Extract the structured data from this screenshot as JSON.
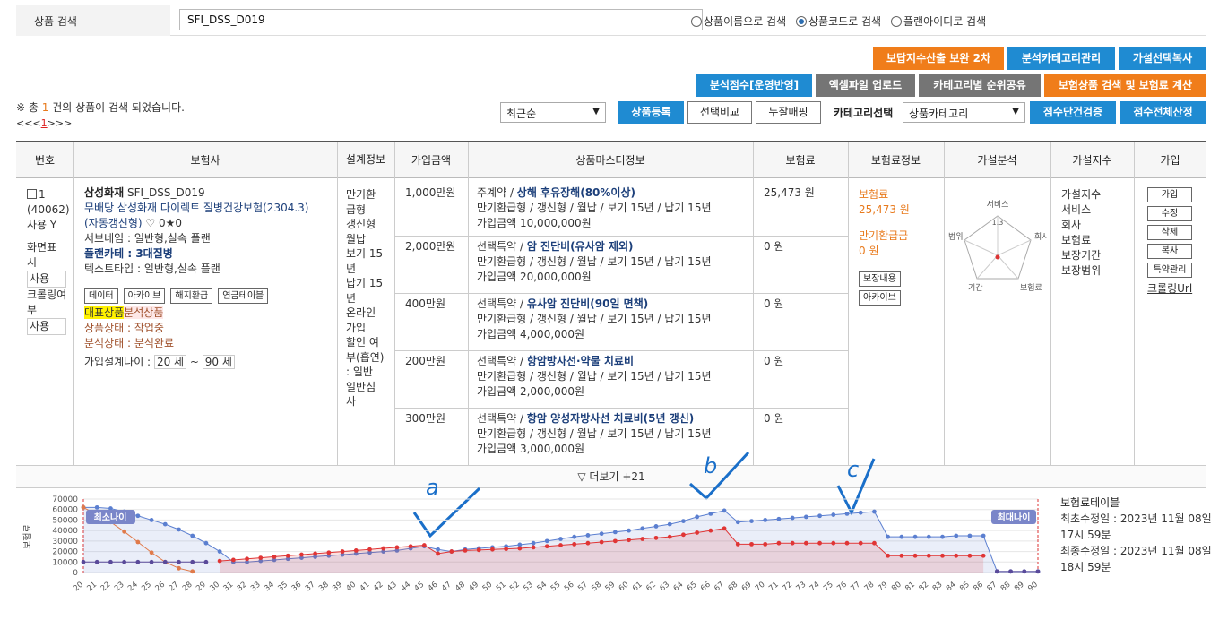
{
  "search": {
    "label": "상품 검색",
    "value": "SFI_DSS_D019",
    "options": [
      {
        "label": "상품이름으로 검색",
        "checked": false
      },
      {
        "label": "상품코드로 검색",
        "checked": true
      },
      {
        "label": "플랜아이디로 검색",
        "checked": false
      }
    ]
  },
  "toolbar": {
    "row1": [
      "보답지수산출 보완 2차",
      "분석카테고리관리",
      "가설선택복사"
    ],
    "row2": [
      "분석점수[운영반영]",
      "엑셀파일 업로드",
      "카테고리별 순위공유",
      "보험상품 검색 및 보험료 계산"
    ],
    "sort_select": "최근순",
    "row3": [
      "상품등록",
      "선택비교",
      "누잘매핑"
    ],
    "category_label": "카테고리선택",
    "category_select": "상품카테고리",
    "row3_right": [
      "점수단건검증",
      "점수전체산정"
    ]
  },
  "result": {
    "prefix": "※ 총 ",
    "count": "1",
    "suffix": " 건의 상품이 검색 되었습니다.",
    "pager_prev": "<<<",
    "pager_current": "1",
    "pager_next": ">>>"
  },
  "table": {
    "headers": [
      "번호",
      "보험사",
      "설계정보",
      "가입금액",
      "상품마스터정보",
      "보험료",
      "보험료정보",
      "가설분석",
      "가설지수",
      "가입"
    ],
    "row": {
      "no": "1",
      "id": "(40062)",
      "use_label": "사용 Y",
      "display_label": "화면표시",
      "display_value": "사용",
      "crawl_label": "크롤링여부",
      "crawl_value": "사용",
      "company": "삼성화재",
      "code": "SFI_DSS_D019",
      "product_name_1": "무배당 삼성화재 다이렉트 질병건강보험(2304.3)",
      "product_name_2": "(자동갱신형)",
      "likes": "♡ 0★0",
      "service_name": "서브네임 : 일반형,실속 플랜",
      "plan_category": "플랜카테 : 3대질병",
      "text_type": "텍스트타입 : 일반형,실속 플랜",
      "action_buttons": [
        "데이터",
        "아카이브",
        "해지환급",
        "연금테이블"
      ],
      "tag1": "대표상품",
      "tag2": "분석상품",
      "status": "상품상태 : 작업중",
      "analysis_status": "분석상태 : 분석완료",
      "age_label": "가입설계나이 :",
      "age_min": "20 세",
      "age_sep": "~",
      "age_max": "90 세",
      "design_info": [
        "만기환",
        "급형",
        "갱신형",
        "월납",
        "보기 15",
        "년",
        "납기 15",
        "년",
        "온라인",
        "가입",
        "할인 여",
        "부(흡연)",
        ": 일반",
        "일반심",
        "사"
      ],
      "coverages": [
        {
          "amount": "1,000만원",
          "type": "주계약",
          "name": "상해 후유장해(80%이상)",
          "detail": "만기환급형 / 갱신형 / 월납 / 보기 15년 / 납기 15년",
          "join": "가입금액 10,000,000원",
          "premium": "25,473 원"
        },
        {
          "amount": "2,000만원",
          "type": "선택특약",
          "name": "암 진단비(유사암 제외)",
          "detail": "만기환급형 / 갱신형 / 월납 / 보기 15년 / 납기 15년",
          "join": "가입금액 20,000,000원",
          "premium": "0 원"
        },
        {
          "amount": "400만원",
          "type": "선택특약",
          "name": "유사암 진단비(90일 면책)",
          "detail": "만기환급형 / 갱신형 / 월납 / 보기 15년 / 납기 15년",
          "join": "가입금액 4,000,000원",
          "premium": "0 원"
        },
        {
          "amount": "200만원",
          "type": "선택특약",
          "name": "항암방사선·약물 치료비",
          "detail": "만기환급형 / 갱신형 / 월납 / 보기 15년 / 납기 15년",
          "join": "가입금액 2,000,000원",
          "premium": "0 원"
        },
        {
          "amount": "300만원",
          "type": "선택특약",
          "name": "항암 양성자방사선 치료비(5년 갱신)",
          "detail": "만기환급형 / 갱신형 / 월납 / 보기 15년 / 납기 15년",
          "join": "가입금액 3,000,000원",
          "premium": "0 원"
        }
      ],
      "premium_info": {
        "premium_label": "보험료",
        "premium_value": "25,473 원",
        "refund_label": "만기환급금",
        "refund_value": "0 원",
        "buttons": [
          "보장내용",
          "아카이브"
        ]
      },
      "radar": {
        "labels": [
          "서비스",
          "회사",
          "보험료",
          "기간",
          "범위"
        ],
        "value_label": "1.3"
      },
      "index_items": [
        "가설지수",
        "서비스",
        "회사",
        "보험료",
        "보장기간",
        "보장범위"
      ],
      "join_buttons": [
        "가입",
        "수정",
        "삭제",
        "복사",
        "특약관리"
      ],
      "crawl_url": "크롤링Url"
    }
  },
  "more": {
    "label": "▽ 더보기 +21"
  },
  "annotations": [
    "a",
    "b",
    "c"
  ],
  "chart_panel": {
    "title": "보험료테이블",
    "first_modified": "최초수정일 : 2023년 11월 08일 17시 59분",
    "last_modified": "최종수정일 : 2023년 11월 08일 18시 59분",
    "min_age_badge": "최소나이",
    "max_age_badge": "최대나이",
    "y_axis_label": "보험료"
  },
  "colors": {
    "blue_series": "#5b7fd0",
    "red_series": "#e03535",
    "orange_series": "#e07a4a",
    "purple_series": "#5a4a9a"
  },
  "chart_data": {
    "type": "line",
    "x": [
      20,
      21,
      22,
      23,
      24,
      25,
      26,
      27,
      28,
      29,
      30,
      31,
      32,
      33,
      34,
      35,
      36,
      37,
      38,
      39,
      40,
      41,
      42,
      43,
      44,
      45,
      46,
      47,
      48,
      49,
      50,
      51,
      52,
      53,
      54,
      55,
      56,
      57,
      58,
      59,
      60,
      61,
      62,
      63,
      64,
      65,
      66,
      67,
      68,
      69,
      70,
      71,
      72,
      73,
      74,
      75,
      76,
      77,
      78,
      79,
      80,
      81,
      82,
      83,
      84,
      85,
      86,
      87,
      88,
      89,
      90
    ],
    "ylim": [
      0,
      70000
    ],
    "yticks": [
      0,
      10000,
      20000,
      30000,
      40000,
      50000,
      60000,
      70000
    ],
    "series": [
      {
        "color": "#5b7fd0",
        "values": [
          62000,
          62000,
          61000,
          58000,
          54000,
          50000,
          46000,
          41000,
          35000,
          28000,
          20000,
          10000,
          10000,
          11000,
          12000,
          13000,
          14000,
          15000,
          16000,
          17000,
          18000,
          19000,
          20000,
          21000,
          23000,
          25000,
          22000,
          20000,
          22000,
          23000,
          24000,
          25000,
          26500,
          28000,
          30000,
          32000,
          34000,
          35500,
          37000,
          38500,
          40000,
          42000,
          44000,
          46000,
          49000,
          53000,
          56000,
          59000,
          48000,
          49000,
          50000,
          51000,
          52000,
          53000,
          54000,
          55000,
          56000,
          57000,
          58000,
          34000,
          34000,
          34000,
          34000,
          34000,
          35000,
          35000,
          35000,
          1000,
          1000,
          1000,
          1000
        ]
      },
      {
        "color": "#e03535",
        "values": [
          null,
          null,
          null,
          null,
          null,
          null,
          null,
          null,
          null,
          null,
          11000,
          12000,
          13000,
          14000,
          15000,
          16000,
          17000,
          18000,
          19000,
          20000,
          21000,
          22000,
          23000,
          24000,
          25000,
          26000,
          18000,
          20000,
          21000,
          21500,
          22000,
          22500,
          23000,
          24000,
          25000,
          26000,
          27000,
          28000,
          29000,
          30000,
          31000,
          32000,
          33000,
          34000,
          36000,
          38000,
          40000,
          42000,
          27000,
          27000,
          27000,
          28000,
          28000,
          28000,
          28000,
          28000,
          28000,
          28000,
          28000,
          16000,
          16000,
          16000,
          16000,
          16000,
          16000,
          16000,
          16000,
          null,
          null,
          null,
          null
        ]
      },
      {
        "color": "#e07a4a",
        "values": [
          62000,
          55000,
          48000,
          39000,
          29000,
          19000,
          10000,
          4000,
          1000,
          null,
          null,
          null,
          null,
          null,
          null,
          null,
          null,
          null,
          null,
          null,
          null,
          null,
          null,
          null,
          null,
          null,
          null,
          null,
          null,
          null,
          null,
          null,
          null,
          null,
          null,
          null,
          null,
          null,
          null,
          null,
          null,
          null,
          null,
          null,
          null,
          null,
          null,
          null,
          null,
          null,
          null,
          null,
          null,
          null,
          null,
          null,
          null,
          null,
          null,
          null,
          null,
          null,
          null,
          null,
          null,
          null,
          null,
          null,
          null,
          null,
          null
        ]
      },
      {
        "color": "#5a4a9a",
        "values": [
          10000,
          10000,
          10000,
          10000,
          10000,
          10000,
          10000,
          10000,
          10000,
          10000,
          null,
          null,
          null,
          null,
          null,
          null,
          null,
          null,
          null,
          null,
          null,
          null,
          null,
          null,
          null,
          null,
          null,
          null,
          null,
          null,
          null,
          null,
          null,
          null,
          null,
          null,
          null,
          null,
          null,
          null,
          null,
          null,
          null,
          null,
          null,
          null,
          null,
          null,
          null,
          null,
          null,
          null,
          null,
          null,
          null,
          null,
          null,
          null,
          null,
          null,
          null,
          null,
          null,
          null,
          null,
          null,
          null,
          1000,
          1000,
          1000,
          1000
        ]
      }
    ]
  }
}
